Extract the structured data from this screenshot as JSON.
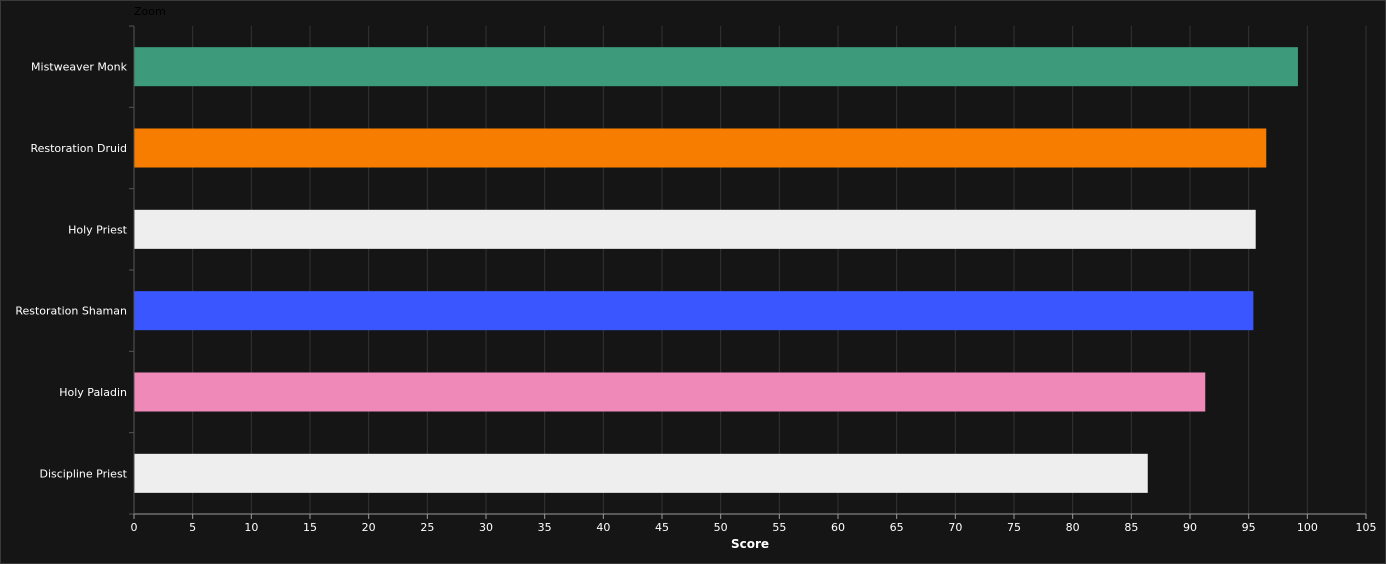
{
  "toolbar": {
    "zoom_label": "Zoom"
  },
  "chart_data": {
    "type": "bar",
    "orientation": "horizontal",
    "categories": [
      "Mistweaver Monk",
      "Restoration Druid",
      "Holy Priest",
      "Restoration Shaman",
      "Holy Paladin",
      "Discipline Priest"
    ],
    "values": [
      99.2,
      96.5,
      95.6,
      95.4,
      91.3,
      86.4
    ],
    "colors": [
      "#3d9a7a",
      "#f77d00",
      "#eeeeee",
      "#3a57ff",
      "#ef89b8",
      "#eeeeee"
    ],
    "title": "",
    "xlabel": "Score",
    "ylabel": "",
    "xlim": [
      0,
      105
    ],
    "xticks": [
      0,
      5,
      10,
      15,
      20,
      25,
      30,
      35,
      40,
      45,
      50,
      55,
      60,
      65,
      70,
      75,
      80,
      85,
      90,
      95,
      100,
      105
    ],
    "grid": true,
    "legend": "none",
    "background": "#151515",
    "grid_color": "#333333"
  }
}
